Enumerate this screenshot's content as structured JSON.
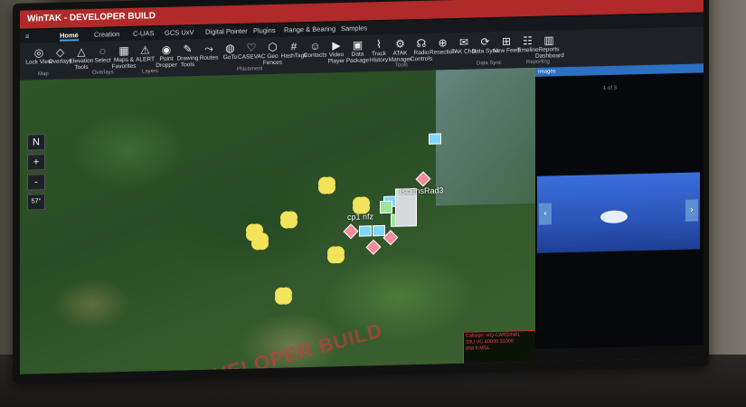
{
  "window": {
    "title": "WinTAK - DEVELOPER BUILD"
  },
  "tabs": [
    {
      "label": "Home"
    },
    {
      "label": "Creation"
    },
    {
      "label": "C-UAS"
    },
    {
      "label": "GCS UxV"
    },
    {
      "label": "Digital Pointer"
    },
    {
      "label": "Plugins"
    },
    {
      "label": "Range & Bearing"
    },
    {
      "label": "Samples"
    }
  ],
  "tools": [
    {
      "label": "Lock View",
      "icon": "target-icon"
    },
    {
      "label": "Overlays",
      "icon": "layers-icon"
    },
    {
      "label": "Elevation Tools",
      "icon": "mountain-icon"
    },
    {
      "label": "Select",
      "icon": "lasso-icon"
    },
    {
      "label": "Maps & Favorites",
      "icon": "map-icon"
    },
    {
      "label": "ALERT",
      "icon": "alert-icon"
    },
    {
      "label": "Point Dropper",
      "icon": "pin-icon"
    },
    {
      "label": "Drawing Tools",
      "icon": "pencil-icon"
    },
    {
      "label": "Routes",
      "icon": "route-icon"
    },
    {
      "label": "GoTo",
      "icon": "globe-icon"
    },
    {
      "label": "CASEVAC",
      "icon": "heart-icon"
    },
    {
      "label": "Geo Fences",
      "icon": "fence-icon"
    },
    {
      "label": "HashTags",
      "icon": "hash-icon"
    },
    {
      "label": "Contacts",
      "icon": "people-icon"
    },
    {
      "label": "Video Player",
      "icon": "video-icon"
    },
    {
      "label": "Data Package",
      "icon": "package-icon"
    },
    {
      "label": "Track History",
      "icon": "track-icon"
    },
    {
      "label": "ATAK Manager",
      "icon": "gear-icon"
    },
    {
      "label": "Radio Controls",
      "icon": "radio-icon"
    },
    {
      "label": "Resection",
      "icon": "resection-icon"
    },
    {
      "label": "TAK Chat",
      "icon": "chat-icon"
    },
    {
      "label": "Data Sync",
      "icon": "sync-icon"
    },
    {
      "label": "New Feed",
      "icon": "feed-icon"
    },
    {
      "label": "Timeline",
      "icon": "timeline-icon"
    },
    {
      "label": "Reports Dashboard",
      "icon": "chart-icon"
    }
  ],
  "groups": [
    "Map",
    "Overlays",
    "Layers",
    "Placement",
    "Tools",
    "Data Sync",
    "Reporting"
  ],
  "map": {
    "labels": [
      "cp1 nfz",
      "IscEnsRad3"
    ],
    "compass": {
      "north": "N",
      "zoom_in": "+",
      "zoom_out": "-",
      "tilt": "57°"
    },
    "watermark": "DEVELOPER BUILD",
    "infobox": [
      "Callsign: HQ-CARDINAL",
      "33U VC 40000 31000",
      "858 ft MSL"
    ]
  },
  "right_panel": {
    "header": "Images",
    "counter": "1 of 3"
  },
  "colors": {
    "title_bar": "#b02a2a",
    "hostile": "#f28b9a",
    "friend": "#7fd6ff",
    "neutral": "#9be69b",
    "unknown": "#f2e35a",
    "selection": "#2d6fc2"
  }
}
